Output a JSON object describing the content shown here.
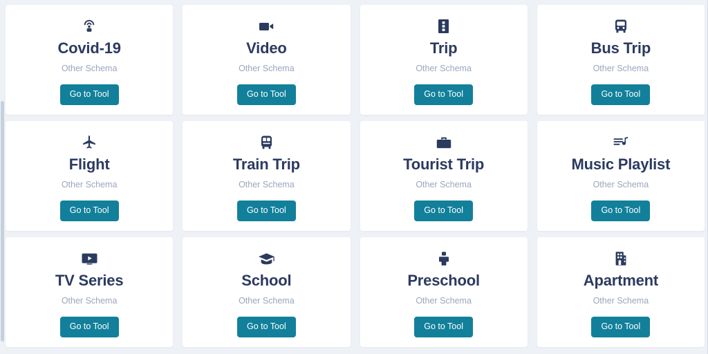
{
  "theme": {
    "page_background": "#eef1f6",
    "card_background": "#ffffff",
    "title_color": "#2c3a60",
    "subtitle_color": "#9aa6be",
    "button_color": "#12809a",
    "button_text_color": "#ffffff",
    "icon_color": "#2b3b5e",
    "scrollbar_thumb_color": "#c6d0dd"
  },
  "common": {
    "subtitle": "Other Schema",
    "button_label": "Go to Tool"
  },
  "cards": [
    {
      "title": "Covid-19",
      "subtitle": "Other Schema",
      "button_label": "Go to Tool",
      "icon": "virus-broadcast-icon"
    },
    {
      "title": "Video",
      "subtitle": "Other Schema",
      "button_label": "Go to Tool",
      "icon": "video-camera-icon"
    },
    {
      "title": "Trip",
      "subtitle": "Other Schema",
      "button_label": "Go to Tool",
      "icon": "suitcase-icon"
    },
    {
      "title": "Bus Trip",
      "subtitle": "Other Schema",
      "button_label": "Go to Tool",
      "icon": "bus-icon"
    },
    {
      "title": "Flight",
      "subtitle": "Other Schema",
      "button_label": "Go to Tool",
      "icon": "airplane-icon"
    },
    {
      "title": "Train Trip",
      "subtitle": "Other Schema",
      "button_label": "Go to Tool",
      "icon": "train-icon"
    },
    {
      "title": "Tourist Trip",
      "subtitle": "Other Schema",
      "button_label": "Go to Tool",
      "icon": "briefcase-icon"
    },
    {
      "title": "Music Playlist",
      "subtitle": "Other Schema",
      "button_label": "Go to Tool",
      "icon": "playlist-music-icon"
    },
    {
      "title": "TV Series",
      "subtitle": "Other Schema",
      "button_label": "Go to Tool",
      "icon": "tv-play-icon"
    },
    {
      "title": "School",
      "subtitle": "Other Schema",
      "button_label": "Go to Tool",
      "icon": "graduation-cap-icon"
    },
    {
      "title": "Preschool",
      "subtitle": "Other Schema",
      "button_label": "Go to Tool",
      "icon": "child-icon"
    },
    {
      "title": "Apartment",
      "subtitle": "Other Schema",
      "button_label": "Go to Tool",
      "icon": "apartment-building-icon"
    }
  ]
}
